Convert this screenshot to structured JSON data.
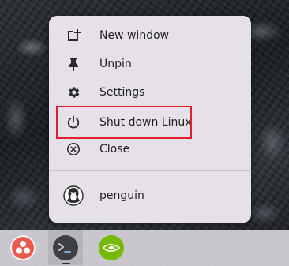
{
  "context_menu": {
    "items": [
      {
        "label": "New window",
        "icon": "new-window-icon"
      },
      {
        "label": "Unpin",
        "icon": "pin-icon"
      },
      {
        "label": "Settings",
        "icon": "gear-icon"
      },
      {
        "label": "Shut down Linux",
        "icon": "power-icon"
      },
      {
        "label": "Close",
        "icon": "close-circle-icon"
      }
    ],
    "profile": {
      "label": "penguin",
      "icon": "penguin-icon"
    }
  },
  "shelf": {
    "apps": [
      {
        "name": "launcher",
        "icon": "three-dots-app-icon",
        "color": "#e8594f"
      },
      {
        "name": "terminal",
        "icon": "terminal-icon",
        "color": "#3c4043",
        "active": true
      },
      {
        "name": "nvidia",
        "icon": "nvidia-icon",
        "color": "#76b900"
      }
    ]
  },
  "colors": {
    "menu_background": "#e6e1e8",
    "highlight_border": "#e0202a",
    "text": "#1f1f1f"
  }
}
